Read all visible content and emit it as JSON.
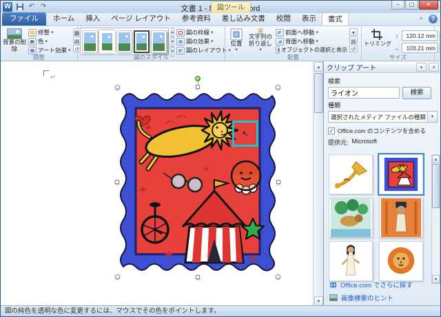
{
  "titlebar": {
    "title": "文書 1 - Microsoft Word",
    "contextual_group": "図ツール"
  },
  "tabs": {
    "file": "ファイル",
    "items": [
      "ホーム",
      "挿入",
      "ページ レイアウト",
      "参考資料",
      "差し込み文書",
      "校閲",
      "表示"
    ],
    "format": "書式"
  },
  "icons": {
    "app": "W",
    "undo": "↶",
    "redo": "↷",
    "minimize": "–",
    "maximize": "▢",
    "close": "✕",
    "help": "?",
    "collapse": "^",
    "dropdown": "▾",
    "up": "▴",
    "scroll_up": "▲",
    "scroll_down": "▼",
    "check": "✓",
    "paragraph": "↵",
    "cursor": "↖",
    "reset": "↺",
    "compress": "▦",
    "change": "▤",
    "gallery_more": "▾",
    "height": "↕",
    "width": "↔"
  },
  "ribbon": {
    "adjust": {
      "label": "調整",
      "remove_bg": "背景の削除",
      "corrections": "修整",
      "color": "色",
      "artistic": "アート効果"
    },
    "styles": {
      "label": "図のスタイル",
      "border": "図の枠線",
      "effects": "図の効果",
      "layout": "図のレイアウト"
    },
    "arrange": {
      "label": "配置",
      "position": "位置",
      "wrap": "文字列の折り返し",
      "forward": "前面へ移動",
      "backward": "背面へ移動",
      "selection": "オブジェクトの選択と表示"
    },
    "size": {
      "label": "サイズ",
      "crop": "トリミング",
      "height": "120.12 mm",
      "width": "103.21 mm"
    }
  },
  "taskpane": {
    "title": "クリップ アート",
    "search_label": "検索",
    "search_value": "ライオン",
    "search_button": "検索",
    "type_label": "種類",
    "type_value": "選択されたメディア ファイルの種類",
    "include_label": "Office.com のコンテンツを含める",
    "provider_label": "提供元:",
    "provider_value": "Microsoft",
    "results": [
      {
        "name": "horn"
      },
      {
        "name": "circus-lion",
        "selected": true
      },
      {
        "name": "jungle-animals"
      },
      {
        "name": "egypt-figure"
      },
      {
        "name": "egypt-woman"
      },
      {
        "name": "lion-head"
      }
    ],
    "more_link": "Office.com でさらに探す",
    "hint_link": "画像検索のヒント"
  },
  "statusbar": {
    "message": "図の純色を透明な色に変更するには、マウスでその色をポイントします。"
  }
}
